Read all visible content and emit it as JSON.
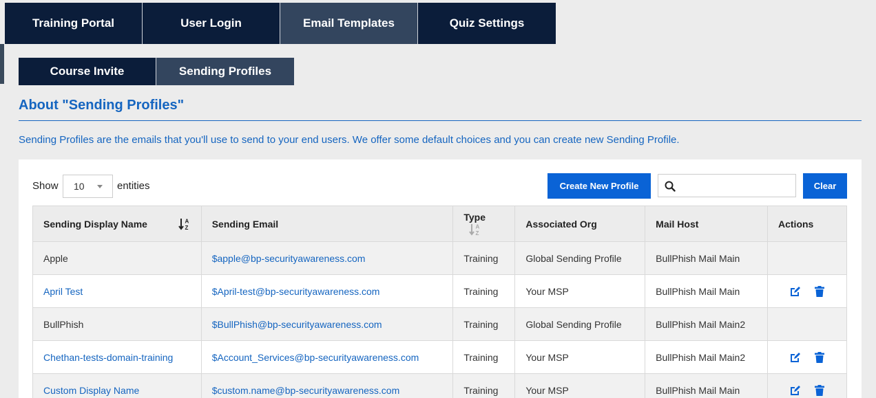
{
  "top_tabs": [
    {
      "label": "Training Portal",
      "active": false
    },
    {
      "label": "User Login",
      "active": false
    },
    {
      "label": "Email Templates",
      "active": true
    },
    {
      "label": "Quiz Settings",
      "active": false
    }
  ],
  "sub_tabs": [
    {
      "label": "Course Invite",
      "active": false
    },
    {
      "label": "Sending Profiles",
      "active": true
    }
  ],
  "about": {
    "title": "About \"Sending Profiles\"",
    "description": "Sending Profiles are the emails that you'll use to send to your end users. We offer some default choices and you can create new Sending Profile."
  },
  "controls": {
    "show_label": "Show",
    "entries_value": "10",
    "entities_label": "entities",
    "create_label": "Create New Profile",
    "search_value": "",
    "clear_label": "Clear"
  },
  "table": {
    "headers": [
      "Sending Display Name",
      "Sending Email",
      "Type",
      "Associated Org",
      "Mail Host",
      "Actions"
    ],
    "rows": [
      {
        "name": "Apple",
        "email": "$apple@bp-securityawareness.com",
        "type": "Training",
        "org": "Global Sending Profile",
        "host": "BullPhish Mail Main",
        "editable": false
      },
      {
        "name": "April Test",
        "email": "$April-test@bp-securityawareness.com",
        "type": "Training",
        "org": "Your MSP",
        "host": "BullPhish Mail Main",
        "editable": true
      },
      {
        "name": "BullPhish",
        "email": "$BullPhish@bp-securityawareness.com",
        "type": "Training",
        "org": "Global Sending Profile",
        "host": "BullPhish Mail Main2",
        "editable": false
      },
      {
        "name": "Chethan-tests-domain-training",
        "email": "$Account_Services@bp-securityawareness.com",
        "type": "Training",
        "org": "Your MSP",
        "host": "BullPhish Mail Main2",
        "editable": true
      },
      {
        "name": "Custom Display Name",
        "email": "$custom.name@bp-securityawareness.com",
        "type": "Training",
        "org": "Your MSP",
        "host": "BullPhish Mail Main",
        "editable": true
      }
    ]
  },
  "colors": {
    "navy": "#0b1d3a",
    "active_tab": "#33455e",
    "accent_blue": "#0a63d6",
    "link_blue": "#1565c0"
  },
  "icons": {
    "search": "search-icon",
    "sort": "sort-alpha-icon",
    "edit": "edit-icon",
    "delete": "trash-icon"
  }
}
